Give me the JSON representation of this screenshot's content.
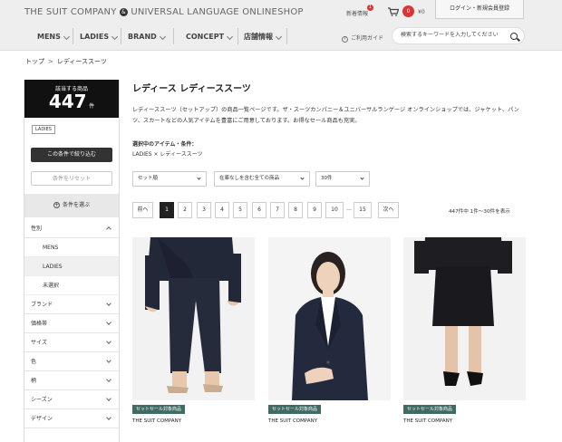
{
  "header": {
    "logo_left": "THE SUIT COMPANY",
    "logo_amp": "&",
    "logo_right": "UNIVERSAL LANGUAGE ONLINESHOP",
    "news_label": "新着情報",
    "news_count": "1",
    "cart_count": "0",
    "cart_total": "¥0",
    "login_label": "ログイン・新規会員登録",
    "nav": [
      "MENS",
      "LADIES",
      "BRAND",
      "CONCEPT",
      "店舗情報"
    ],
    "guide_label": "ご利用ガイド",
    "search_placeholder": "検索するキーワードを入力してください"
  },
  "breadcrumb": {
    "home": "トップ",
    "sep": ">",
    "current": "レディーススーツ"
  },
  "sidebar": {
    "count_label": "該当する商品",
    "count_value": "447",
    "count_unit": "件",
    "active_tag": "LADIES",
    "narrow_button": "この条件で絞り込む",
    "reset_button": "条件をリセット",
    "choose_label": "条件を選ぶ",
    "gender_facet": "性別",
    "gender_options": [
      "MENS",
      "LADIES",
      "未選択"
    ],
    "selected_option": "LADIES",
    "facets": [
      "ブランド",
      "価格帯",
      "サイズ",
      "色",
      "柄",
      "シーズン",
      "デザイン"
    ]
  },
  "main": {
    "title": "レディース レディーススーツ",
    "description": "レディーススーツ（セットアップ）の商品一覧ページです。ザ・スーツカンパニー＆ユニバーサルランゲージ オンラインショップでは、ジャケット、パンツ、スカートなどの人気アイテムを豊富にご用意しております。お得なセール商品も充実。",
    "selected_label": "選択中のアイテム・条件：",
    "selected_value": "LADIES × レディーススーツ",
    "sort_select": "セット順",
    "stock_select": "在庫なしを含む全ての商品",
    "perpage_select": "30件",
    "pager": {
      "prev": "前へ",
      "pages": [
        "1",
        "2",
        "3",
        "4",
        "5",
        "6",
        "7",
        "8",
        "9",
        "10",
        "...",
        "15"
      ],
      "current": "1",
      "next": "次へ",
      "info": "447件中 1件〜30件を表示"
    }
  },
  "products": [
    {
      "badge": "セットセール対象商品",
      "brand": "THE SUIT COMPANY",
      "image": "navy-pant-suit-photo"
    },
    {
      "badge": "セットセール対象商品",
      "brand": "THE SUIT COMPANY",
      "image": "navy-jacket-model-photo"
    },
    {
      "badge": "セットセール対象商品",
      "brand": "THE SUIT COMPANY",
      "image": "black-skirt-suit-photo"
    }
  ],
  "colors": {
    "header_bg": "#eeeeee",
    "badge": "#3f6b63",
    "alert": "#dd3333",
    "dark": "#111111"
  }
}
